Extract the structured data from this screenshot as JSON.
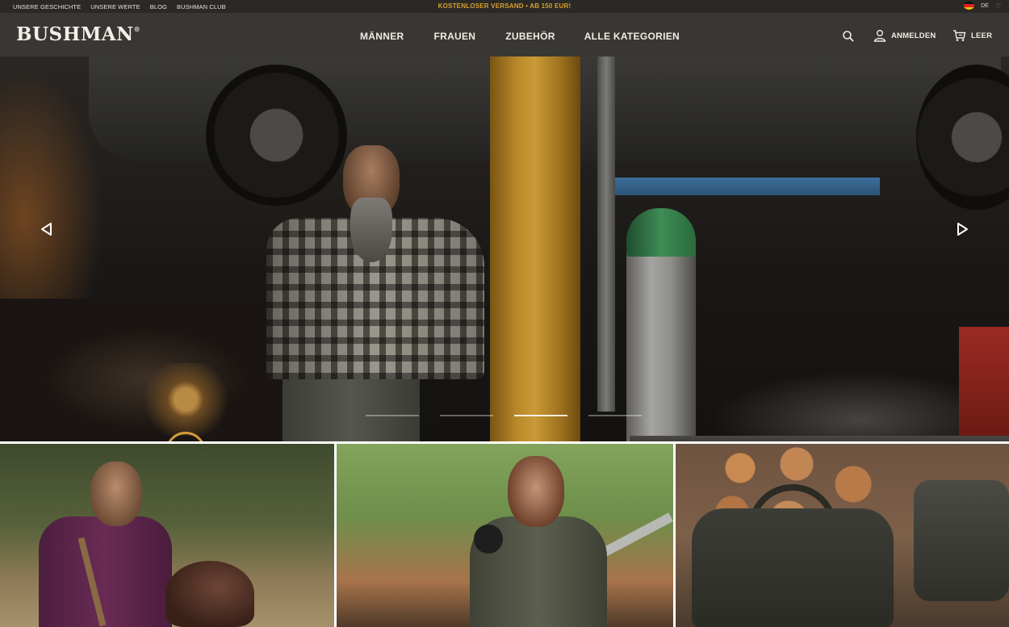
{
  "topbar": {
    "links": [
      "UNSERE GESCHICHTE",
      "UNSERE WERTE",
      "BLOG",
      "BUSHMAN CLUB"
    ],
    "promo": "KOSTENLOSER VERSAND • AB 150 EUR!",
    "lang_code": "DE",
    "heart": "♡"
  },
  "header": {
    "logo": "BUSHMAN",
    "logo_mark": "®",
    "nav": [
      "MÄNNER",
      "FRAUEN",
      "ZUBEHÖR",
      "ALLE KATEGORIEN"
    ],
    "login": "ANMELDEN",
    "cart": "LEER"
  },
  "hero": {
    "slides": 4,
    "active_slide": 3
  },
  "colors": {
    "topbar_bg": "#2b2925",
    "promo": "#d7a12e",
    "header_bg": "#2a2824"
  },
  "icons": {
    "search": "search-icon",
    "user": "user-icon",
    "cart": "cart-icon",
    "prev": "chevron-left-icon",
    "next": "chevron-right-icon"
  }
}
